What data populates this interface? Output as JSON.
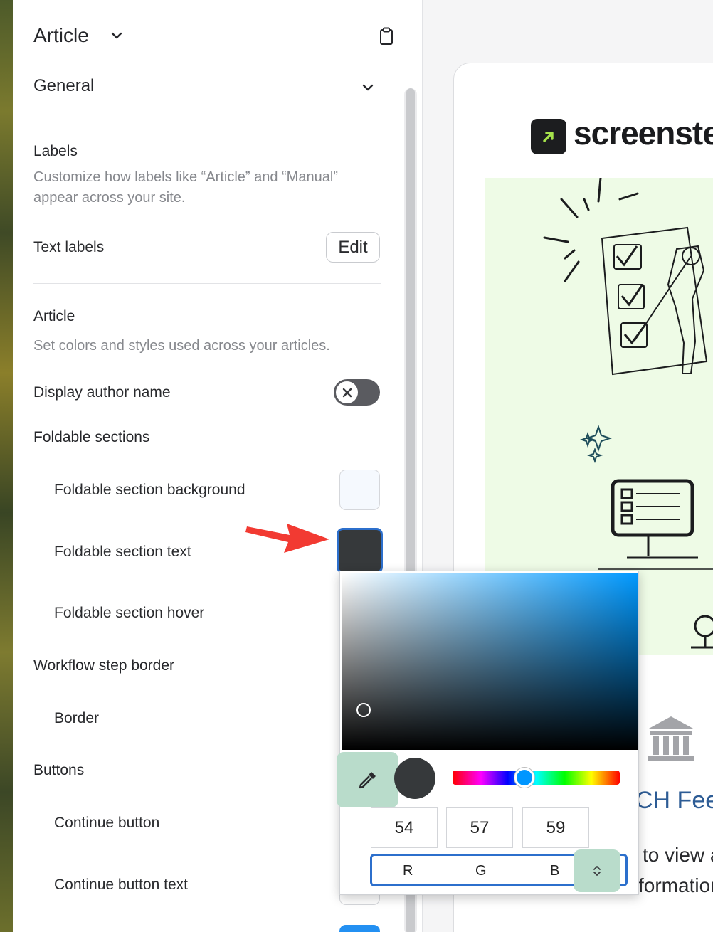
{
  "header": {
    "title": "Article"
  },
  "general": {
    "title": "General"
  },
  "labels": {
    "title": "Labels",
    "description": "Customize how labels like “Article” and “Manual” appear across your site.",
    "text_labels": "Text labels",
    "edit_button": "Edit"
  },
  "article": {
    "title": "Article",
    "description": "Set colors and styles used across your articles.",
    "display_author_name": "Display author name"
  },
  "foldable": {
    "title": "Foldable sections",
    "background": "Foldable section background",
    "text": "Foldable section text",
    "hover": "Foldable section hover"
  },
  "workflow": {
    "title": "Workflow step border",
    "border": "Border"
  },
  "buttons": {
    "title": "Buttons",
    "continue": "Continue button",
    "continue_text": "Continue button text"
  },
  "colors": {
    "swatch_background": "#f5f9fe",
    "swatch_text": "#36393b",
    "accent": "#2c6fcc"
  },
  "picker": {
    "r_value": "54",
    "g_value": "57",
    "b_value": "59",
    "r_label": "R",
    "g_label": "G",
    "b_label": "B"
  },
  "preview": {
    "logo_text": "screenste",
    "heading": "CH Fees",
    "line1": "to view a",
    "line2": "formation"
  }
}
